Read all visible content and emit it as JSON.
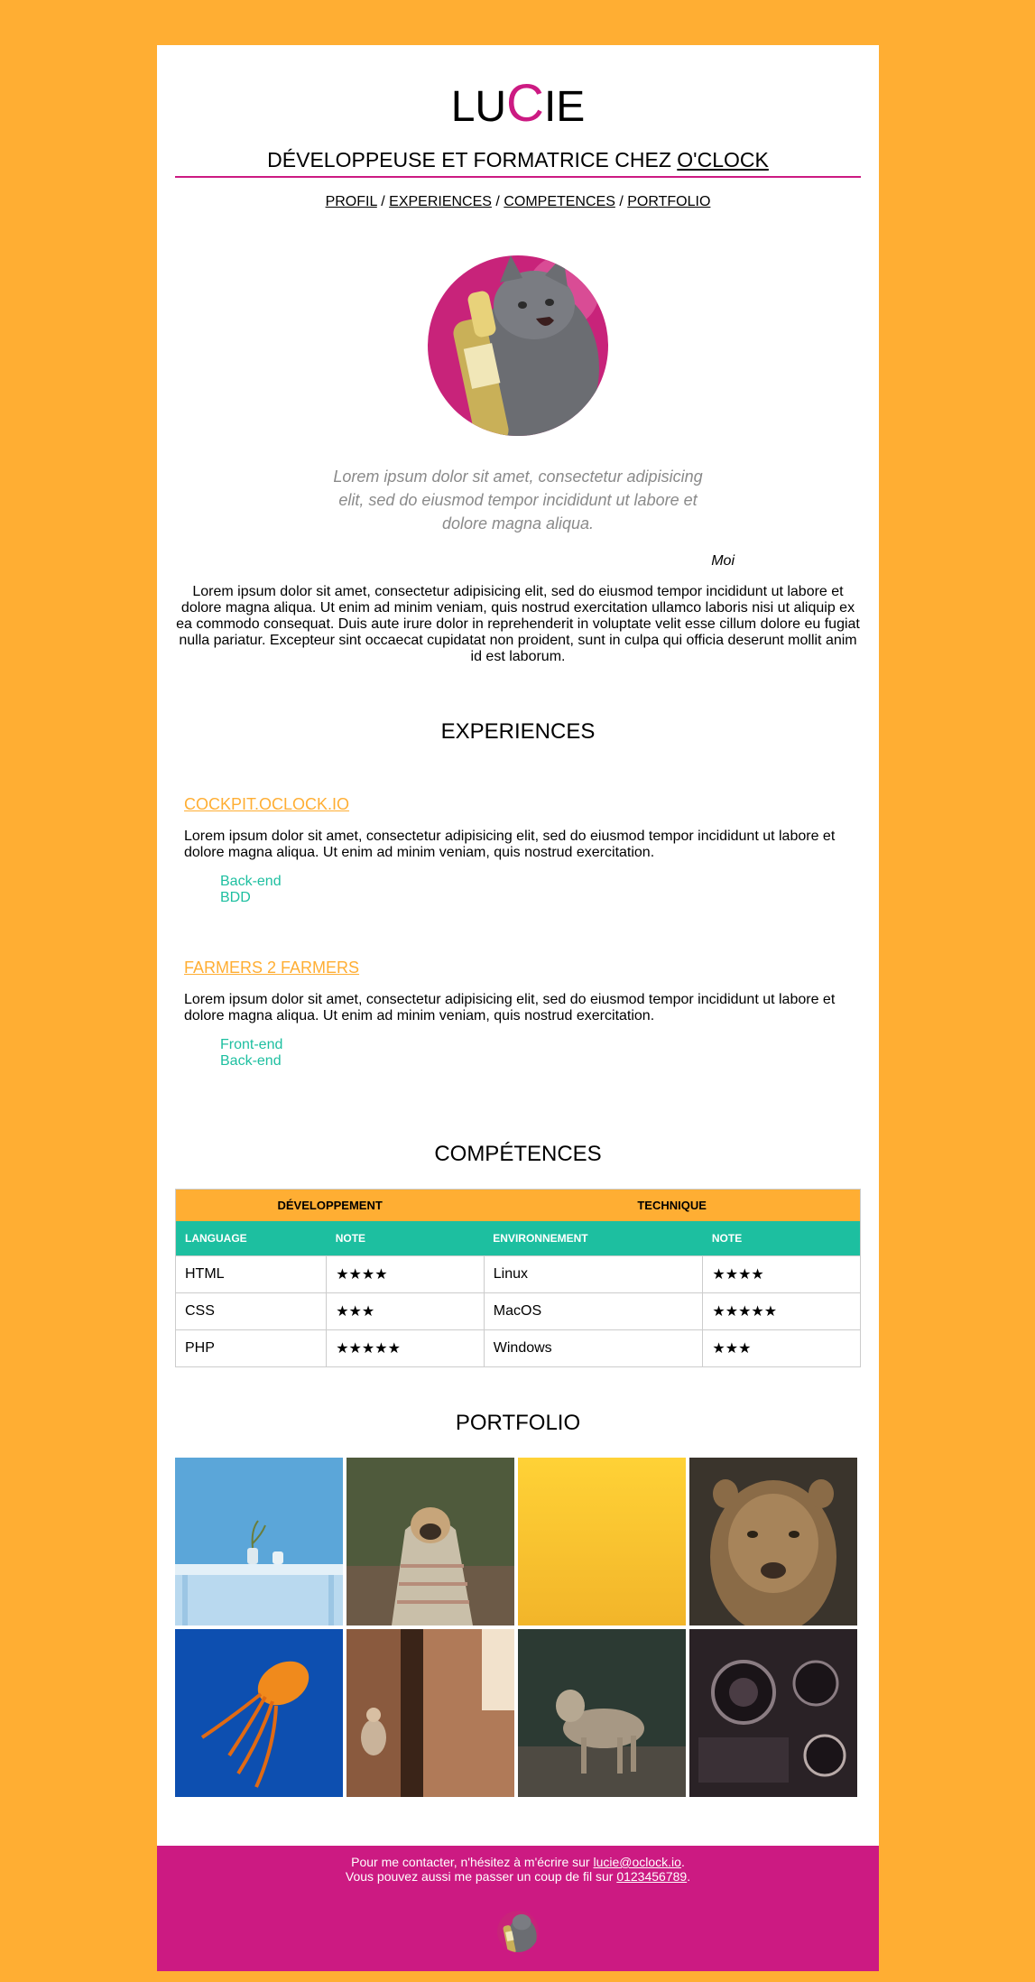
{
  "header": {
    "name_start": "LU",
    "name_accent": "C",
    "name_end": "IE",
    "subtitle": "DÉVELOPPEUSE ET FORMATRICE CHEZ",
    "subtitle_link": "O'CLOCK"
  },
  "nav": {
    "items": [
      "PROFIL",
      "EXPERIENCES",
      "COMPETENCES",
      "PORTFOLIO"
    ],
    "separator": "/"
  },
  "profile": {
    "quote": "Lorem ipsum dolor sit amet, consectetur adipisicing elit, sed do eiusmod tempor incididunt ut labore et dolore magna aliqua.",
    "quote_author": "Moi",
    "bio": "Lorem ipsum dolor sit amet, consectetur adipisicing elit, sed do eiusmod tempor incididunt ut labore et dolore magna aliqua. Ut enim ad minim veniam, quis nostrud exercitation ullamco laboris nisi ut aliquip ex ea commodo consequat. Duis aute irure dolor in reprehenderit in voluptate velit esse cillum dolore eu fugiat nulla pariatur. Excepteur sint occaecat cupidatat non proident, sunt in culpa qui officia deserunt mollit anim id est laborum."
  },
  "experiences": {
    "title": "EXPERIENCES",
    "jobs": [
      {
        "title": "COCKPIT.OCLOCK.IO",
        "description": "Lorem ipsum dolor sit amet, consectetur adipisicing elit, sed do eiusmod tempor incididunt ut labore et dolore magna aliqua. Ut enim ad minim veniam, quis nostrud exercitation.",
        "tags": [
          "Back-end",
          "BDD"
        ]
      },
      {
        "title": "FARMERS 2 FARMERS",
        "description": "Lorem ipsum dolor sit amet, consectetur adipisicing elit, sed do eiusmod tempor incididunt ut labore et dolore magna aliqua. Ut enim ad minim veniam, quis nostrud exercitation.",
        "tags": [
          "Front-end",
          "Back-end"
        ]
      }
    ]
  },
  "skills": {
    "title": "COMPÉTENCES",
    "group_headers": [
      "DÉVELOPPEMENT",
      "TECHNIQUE"
    ],
    "column_headers": [
      "LANGUAGE",
      "NOTE",
      "ENVIRONNEMENT",
      "NOTE"
    ],
    "rows": [
      [
        "HTML",
        "★★★★",
        "Linux",
        "★★★★"
      ],
      [
        "CSS",
        "★★★",
        "MacOS",
        "★★★★★"
      ],
      [
        "PHP",
        "★★★★★",
        "Windows",
        "★★★"
      ]
    ]
  },
  "portfolio": {
    "title": "PORTFOLIO",
    "images": [
      "plant-on-table",
      "pug-in-blanket",
      "yellow-wall",
      "lioness",
      "jellyfish",
      "person-in-doorway",
      "coyote",
      "vintage-cameras"
    ]
  },
  "footer": {
    "line1_prefix": "Pour me contacter, n'hésitez à m'écrire sur",
    "email": "lucie@oclock.io",
    "line2_prefix": "Vous pouvez aussi me passer un coup de fil sur",
    "phone": "0123456789",
    "period": "."
  },
  "colors": {
    "background": "#ffae33",
    "accent_pink": "#cc1a82",
    "accent_teal": "#1dbfa0"
  }
}
